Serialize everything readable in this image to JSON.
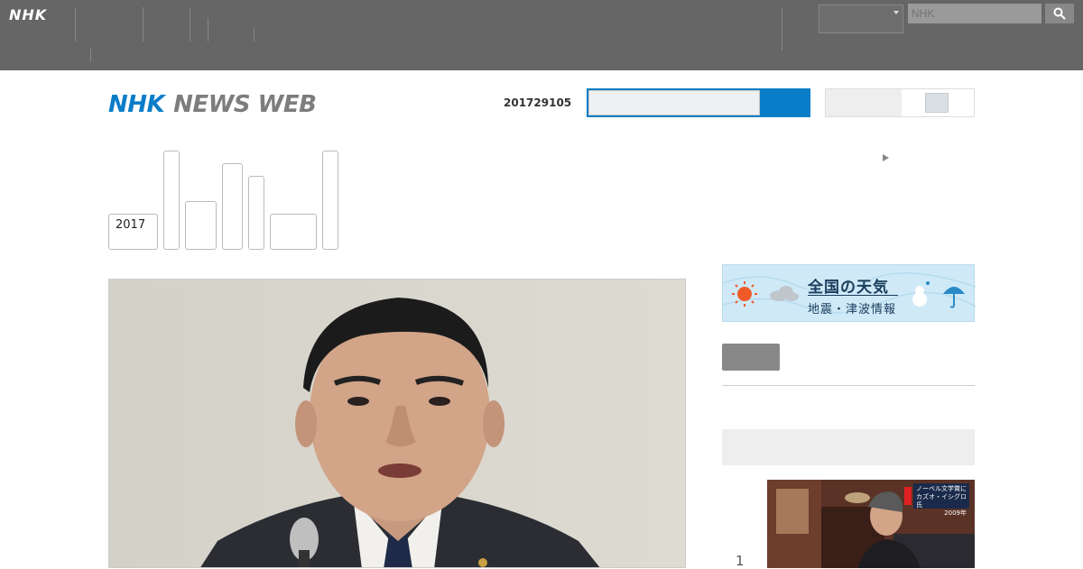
{
  "global_header": {
    "logo": "NHK",
    "search_placeholder": "NHK",
    "language": "",
    "colors": {
      "bar": "#666666"
    }
  },
  "news_header": {
    "logo_a": "NHK",
    "logo_b": "NEWS WEB",
    "date": "201729105",
    "toggle_label": "",
    "top_right_link": "",
    "colors": {
      "brand": "#0a7dc8"
    }
  },
  "category_tabs": [
    {
      "line1": "",
      "line2": "2017"
    },
    {
      "line1": "",
      "line2": ""
    },
    {
      "line1": "",
      "line2": ""
    },
    {
      "line1": "",
      "line2": ""
    },
    {
      "line1": "",
      "line2": ""
    },
    {
      "line1": "",
      "line2": ""
    },
    {
      "line1": "",
      "line2": ""
    }
  ],
  "sidebar": {
    "weather_title": "全国の天気",
    "weather_sub": "地震・津波情報",
    "side_link": "",
    "ranking_heading": "",
    "ranking": [
      {
        "rank": "1",
        "caption_line1": "ノーベル文学賞に",
        "caption_line2": "カズオ・イシグロ氏",
        "caption_line3": "2009年"
      }
    ]
  }
}
